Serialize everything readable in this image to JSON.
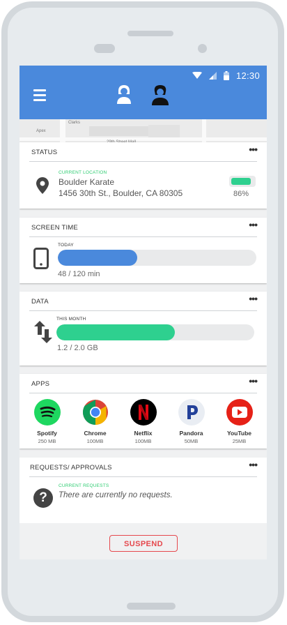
{
  "statusbar": {
    "time": "12:30"
  },
  "status": {
    "title": "STATUS",
    "menu": "•••",
    "location_label": "CURRENT LOCATION",
    "place": "Boulder Karate",
    "address": "1456 30th St., Boulder, CA 80305",
    "battery_percent_text": "86%",
    "battery_level": 0.86
  },
  "map": {
    "labels": [
      "Clarks",
      "Apex",
      "29th Street Mall"
    ]
  },
  "screen_time": {
    "title": "SCREEN TIME",
    "menu": "•••",
    "period_label": "TODAY",
    "usage_text": "48 / 120 min",
    "used": 48,
    "limit": 120,
    "color": "#4a89dc"
  },
  "data": {
    "title": "DATA",
    "menu": "•••",
    "period_label": "THIS MONTH",
    "usage_text": "1.2 / 2.0 GB",
    "used": 1.2,
    "limit": 2.0,
    "color": "#2ed08f"
  },
  "apps": {
    "title": "APPS",
    "menu": "•••",
    "items": [
      {
        "name": "Spotify",
        "size": "250 MB",
        "icon": "spotify-icon"
      },
      {
        "name": "Chrome",
        "size": "100MB",
        "icon": "chrome-icon"
      },
      {
        "name": "Netflix",
        "size": "100MB",
        "icon": "netflix-icon"
      },
      {
        "name": "Pandora",
        "size": "50MB",
        "icon": "pandora-icon"
      },
      {
        "name": "YouTube",
        "size": "25MB",
        "icon": "youtube-icon"
      }
    ]
  },
  "requests": {
    "title": "REQUESTS/ APPROVALS",
    "menu": "•••",
    "label": "CURRENT REQUESTS",
    "empty_text": "There are currently no requests."
  },
  "actions": {
    "suspend": "SUSPEND"
  },
  "colors": {
    "accent": "#4a89dc",
    "green": "#2ed08f",
    "danger": "#e5484d"
  }
}
